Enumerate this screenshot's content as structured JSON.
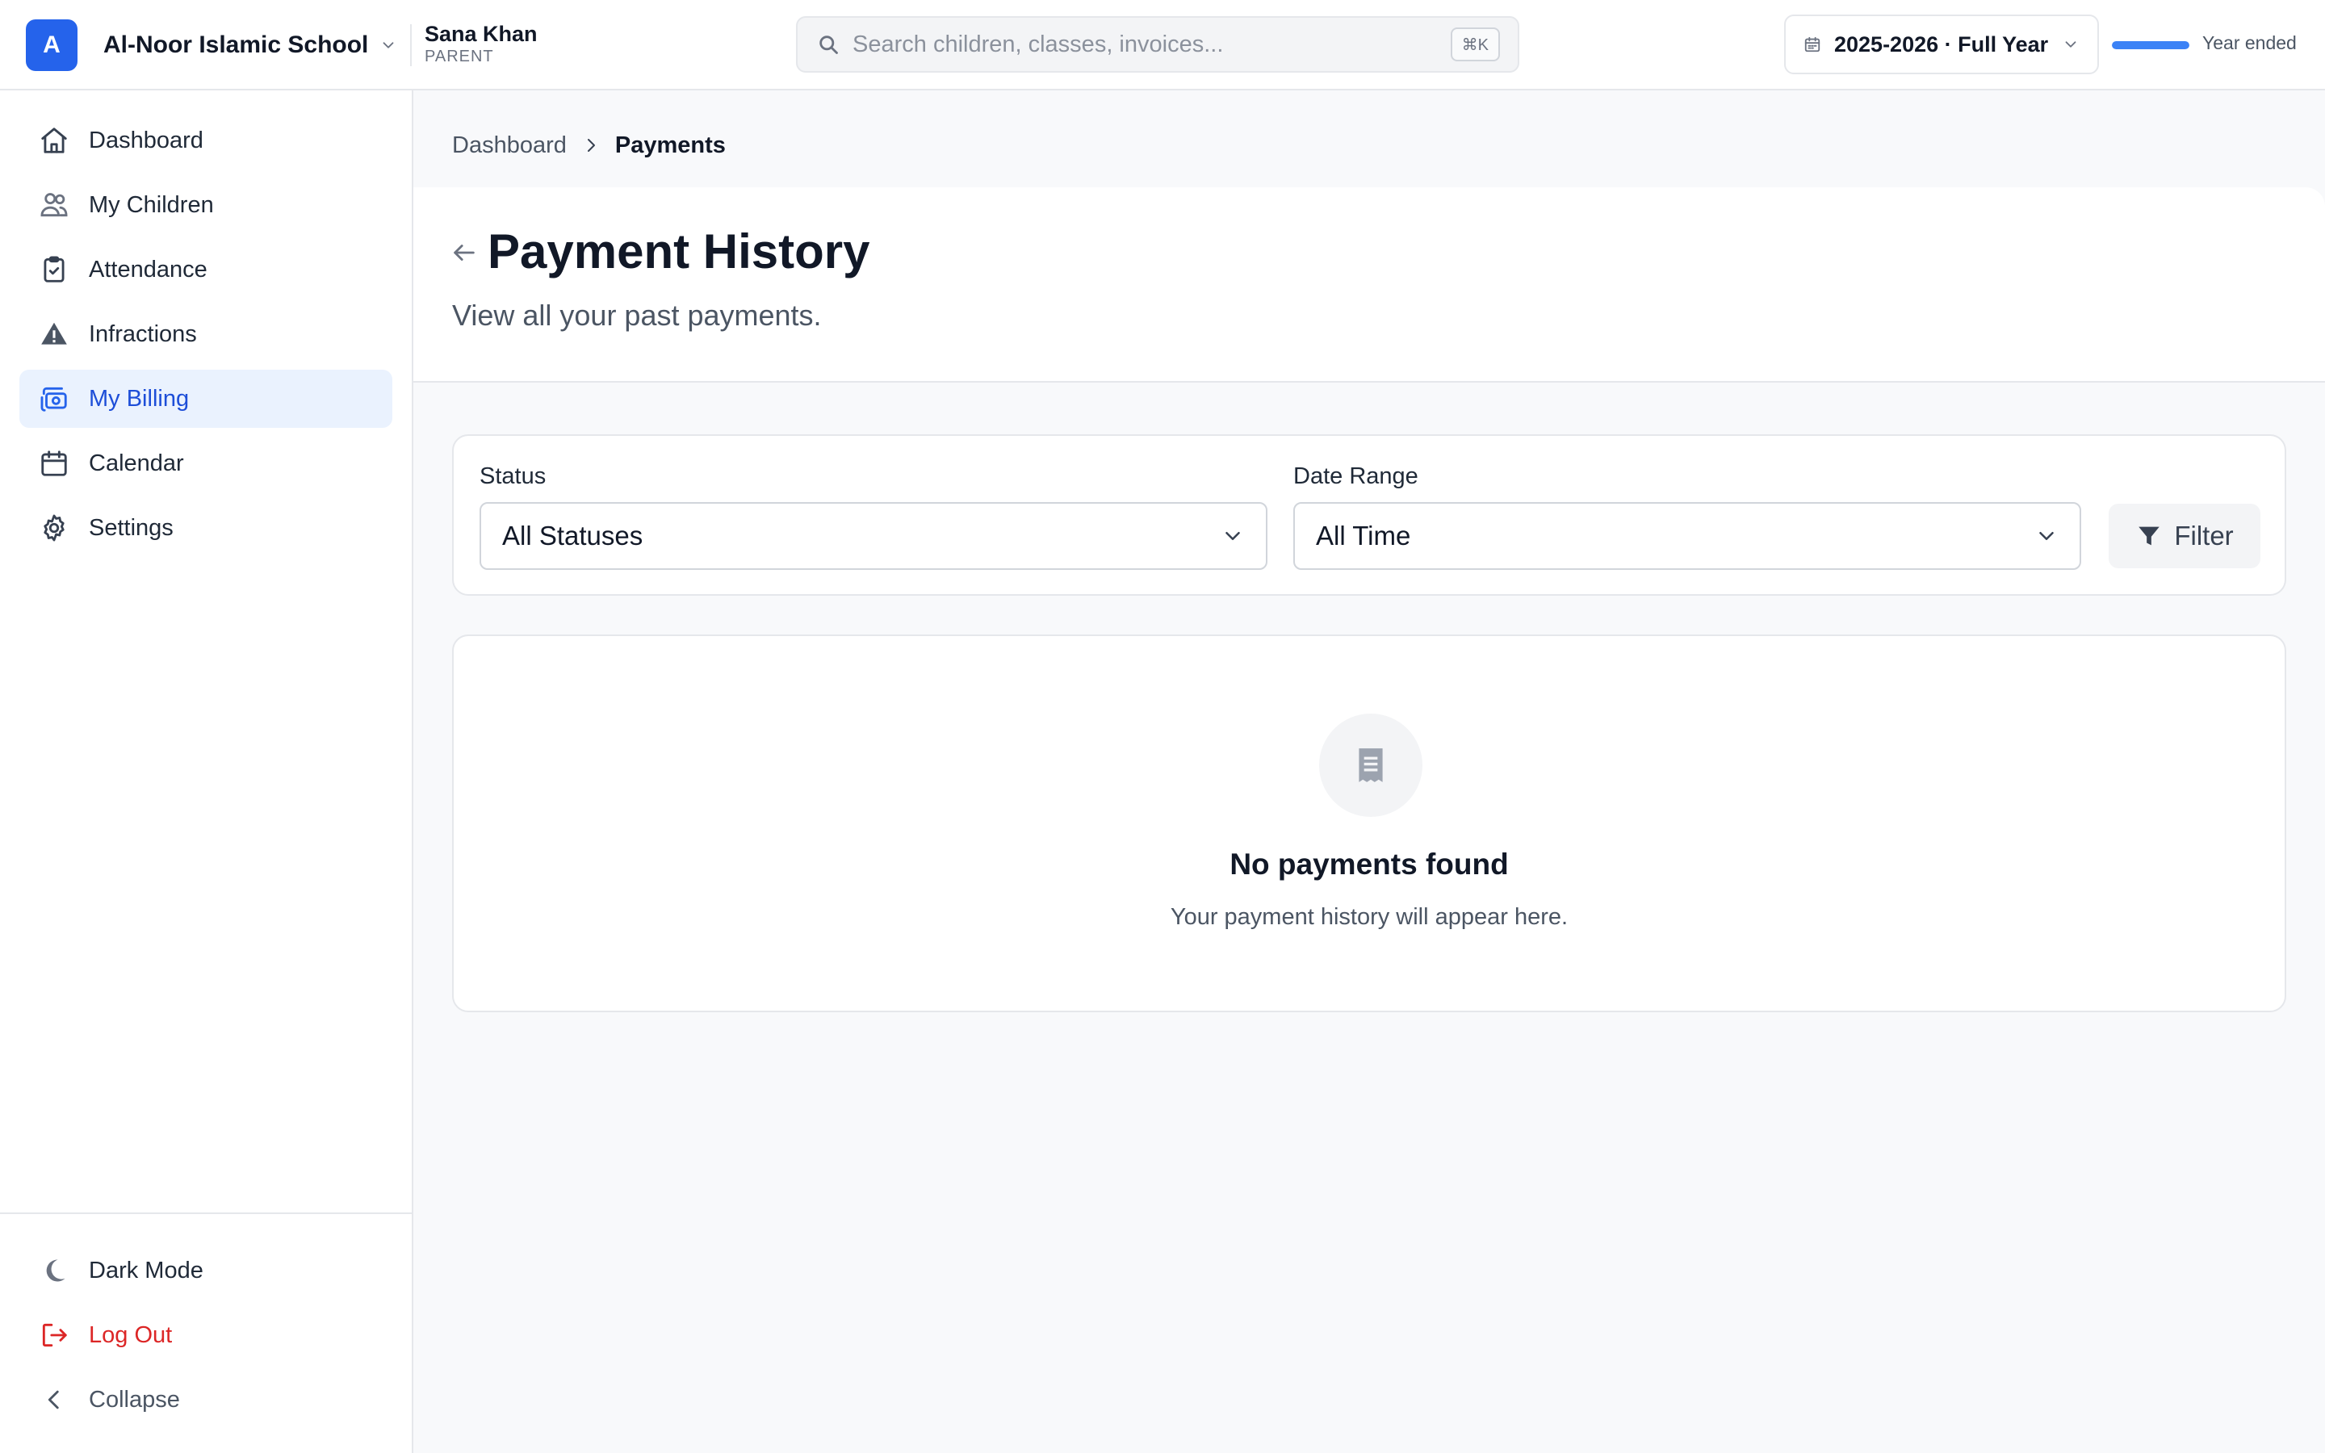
{
  "topbar": {
    "logo_letter": "A",
    "school_name": "Al-Noor Islamic School",
    "user_name": "Sana Khan",
    "user_role": "PARENT",
    "search_placeholder": "Search children, classes, invoices...",
    "search_shortcut": "⌘K",
    "year_label": "2025-2026 · Full Year",
    "year_progress": 1.0,
    "year_status": "Year ended"
  },
  "sidebar": {
    "items": [
      {
        "label": "Dashboard",
        "icon": "home-icon"
      },
      {
        "label": "My Children",
        "icon": "users-icon"
      },
      {
        "label": "Attendance",
        "icon": "clipboard-check-icon"
      },
      {
        "label": "Infractions",
        "icon": "warning-icon"
      },
      {
        "label": "My Billing",
        "icon": "billing-icon",
        "active": true
      },
      {
        "label": "Calendar",
        "icon": "calendar-icon"
      },
      {
        "label": "Settings",
        "icon": "gear-icon"
      }
    ],
    "bottom": {
      "dark_mode": "Dark Mode",
      "log_out": "Log Out",
      "collapse": "Collapse"
    }
  },
  "breadcrumb": {
    "parent": "Dashboard",
    "current": "Payments"
  },
  "header": {
    "title": "Payment History",
    "subtitle": "View all your past payments."
  },
  "filters": {
    "status_label": "Status",
    "status_value": "All Statuses",
    "date_label": "Date Range",
    "date_value": "All Time",
    "filter_button": "Filter"
  },
  "empty_state": {
    "title": "No payments found",
    "message": "Your payment history will appear here."
  },
  "colors": {
    "accent": "#2563eb",
    "active_bg": "#eaf2fe",
    "danger": "#dc2626"
  }
}
